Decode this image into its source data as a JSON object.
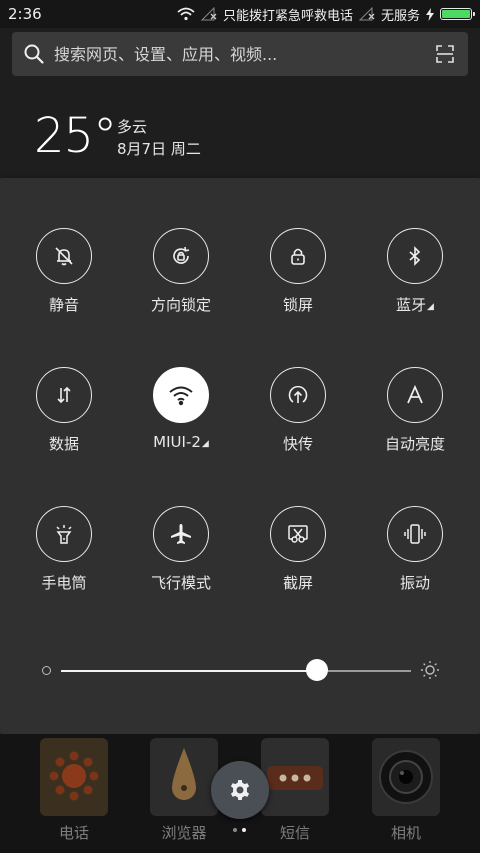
{
  "status_bar": {
    "time": "2:36",
    "emergency_text": "只能拨打紧急呼救电话",
    "service_text": "无服务",
    "battery_level": 1.0,
    "battery_color": "#4cd964"
  },
  "search": {
    "placeholder": "搜索网页、设置、应用、视频..."
  },
  "weather": {
    "temperature": "25°",
    "condition": "多云",
    "date": "8月7日 周二"
  },
  "quick_settings": {
    "tiles": [
      {
        "id": "mute",
        "label": "静音",
        "icon": "bell-off-icon",
        "active": false
      },
      {
        "id": "rotation-lock",
        "label": "方向锁定",
        "icon": "rotation-lock-icon",
        "active": false
      },
      {
        "id": "lock-screen",
        "label": "锁屏",
        "icon": "lock-icon",
        "active": false
      },
      {
        "id": "bluetooth",
        "label": "蓝牙",
        "icon": "bluetooth-icon",
        "active": false
      },
      {
        "id": "data",
        "label": "数据",
        "icon": "data-arrows-icon",
        "active": false
      },
      {
        "id": "wifi",
        "label": "MIUI-2",
        "icon": "wifi-icon",
        "active": true
      },
      {
        "id": "quick-transfer",
        "label": "快传",
        "icon": "transfer-icon",
        "active": false
      },
      {
        "id": "auto-brightness",
        "label": "自动亮度",
        "icon": "auto-brightness-icon",
        "active": false
      },
      {
        "id": "flashlight",
        "label": "手电筒",
        "icon": "flashlight-icon",
        "active": false
      },
      {
        "id": "airplane",
        "label": "飞行模式",
        "icon": "airplane-icon",
        "active": false
      },
      {
        "id": "screenshot",
        "label": "截屏",
        "icon": "scissors-icon",
        "active": false
      },
      {
        "id": "vibrate",
        "label": "振动",
        "icon": "vibrate-icon",
        "active": false
      }
    ],
    "brightness_level": 0.73
  },
  "dock": {
    "apps": [
      {
        "label": "电话",
        "icon": "phone-app-icon"
      },
      {
        "label": "浏览器",
        "icon": "browser-app-icon"
      },
      {
        "label": "短信",
        "icon": "sms-app-icon"
      },
      {
        "label": "相机",
        "icon": "camera-app-icon"
      }
    ],
    "page_count": 2,
    "current_page": 2
  }
}
